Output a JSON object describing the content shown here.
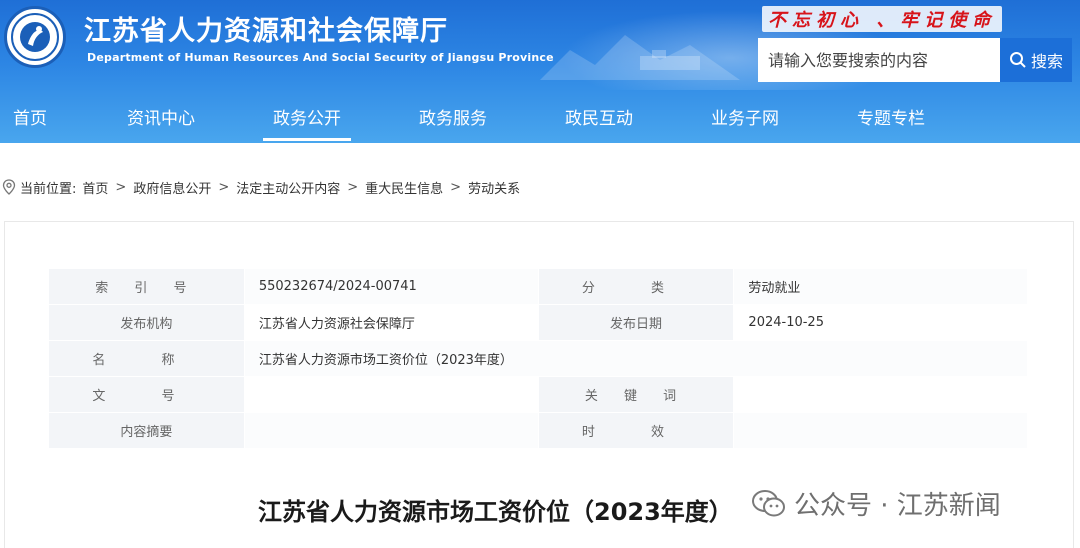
{
  "header": {
    "title_cn": "江苏省人力资源和社会保障厅",
    "title_en": "Department of Human Resources And Social Security of Jiangsu Province",
    "slogan": "不忘初心 、牢记使命",
    "logo_icon": "ministry-emblem-icon"
  },
  "search": {
    "placeholder": "请输入您要搜索的内容",
    "button_label": "搜索"
  },
  "nav": {
    "items": [
      {
        "label": "首页"
      },
      {
        "label": "资讯中心"
      },
      {
        "label": "政务公开",
        "active": true
      },
      {
        "label": "政务服务"
      },
      {
        "label": "政民互动"
      },
      {
        "label": "业务子网"
      },
      {
        "label": "专题专栏"
      }
    ]
  },
  "breadcrumb": {
    "prefix": "当前位置:",
    "items": [
      "首页",
      "政府信息公开",
      "法定主动公开内容",
      "重大民生信息",
      "劳动关系"
    ]
  },
  "meta": {
    "index_label": "索 引 号",
    "index_value": "550232674/2024-00741",
    "category_label": "分 类",
    "category_value": "劳动就业",
    "publisher_label": "发布机构",
    "publisher_value": "江苏省人力资源社会保障厅",
    "date_label": "发布日期",
    "date_value": "2024-10-25",
    "name_label": "名 称",
    "name_value": "江苏省人力资源市场工资价位（2023年度）",
    "docno_label": "文 号",
    "docno_value": "",
    "keywords_label": "关 键 词",
    "keywords_value": "",
    "summary_label": "内容摘要",
    "summary_value": "",
    "validity_label": "时 效",
    "validity_value": ""
  },
  "document": {
    "title": "江苏省人力资源市场工资价位（2023年度）"
  },
  "watermark": {
    "text": "公众号 · 江苏新闻",
    "icon": "wechat-icon"
  },
  "colors": {
    "header_blue": "#2d86e4",
    "search_button": "#1c6fd8",
    "slogan_red": "#d7141a",
    "label_bg": "#f3f5f8"
  }
}
